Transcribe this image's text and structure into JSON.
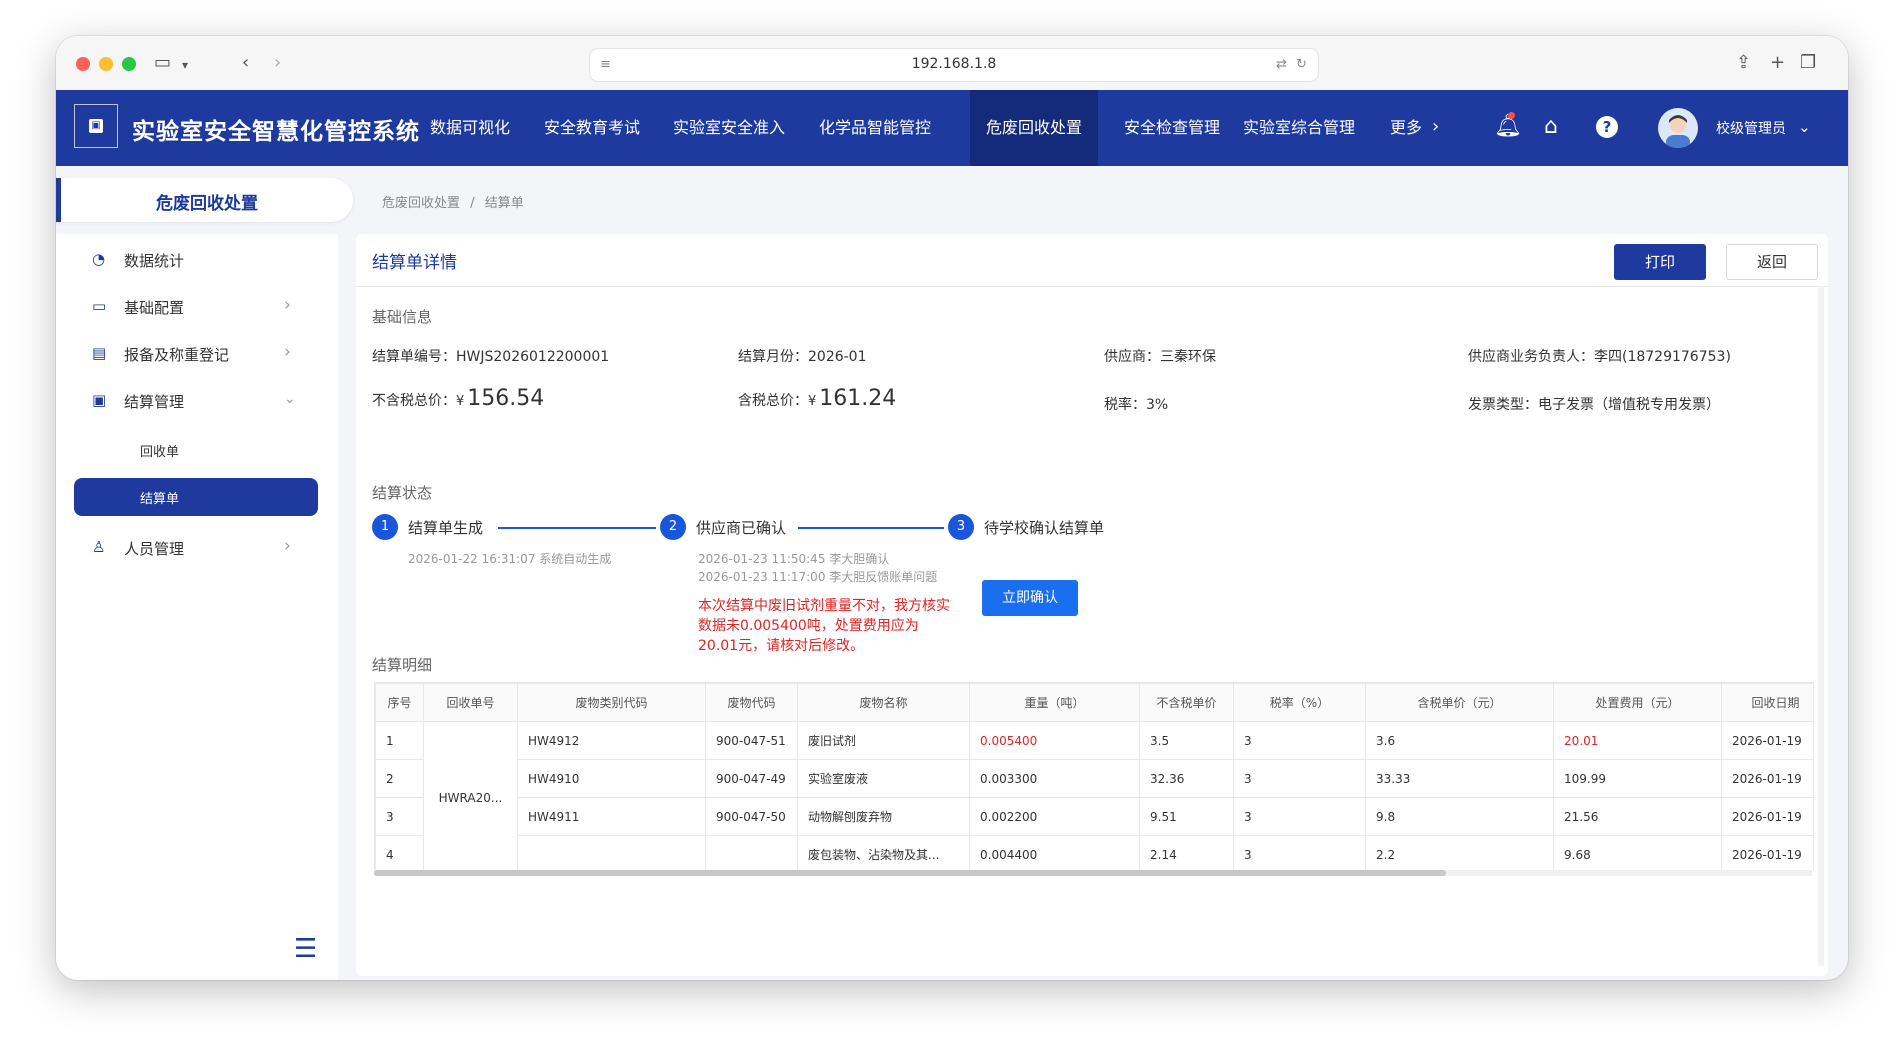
{
  "browser": {
    "url": "192.168.1.8"
  },
  "app": {
    "title": "实验室安全智慧化管控系统",
    "nav": [
      {
        "label": "数据可视化",
        "active": false
      },
      {
        "label": "安全教育考试",
        "active": false
      },
      {
        "label": "实验室安全准入",
        "active": false
      },
      {
        "label": "化学品智能管控",
        "active": false
      },
      {
        "label": "危废回收处置",
        "active": true
      },
      {
        "label": "安全检查管理",
        "active": false
      },
      {
        "label": "实验室综合管理",
        "active": false
      },
      {
        "label": "更多",
        "active": false
      }
    ],
    "user": "校级管理员",
    "colors": {
      "primary": "#1e3a9e",
      "accent": "#1a56db",
      "danger": "#e02424"
    }
  },
  "sidebar": {
    "header": "危废回收处置",
    "items": [
      {
        "label": "数据统计",
        "icon": "pie-chart-icon"
      },
      {
        "label": "基础配置",
        "icon": "monitor-icon"
      },
      {
        "label": "报备及称重登记",
        "icon": "document-icon"
      },
      {
        "label": "结算管理",
        "icon": "bill-icon"
      },
      {
        "label": "人员管理",
        "icon": "user-icon"
      }
    ],
    "subitems": [
      {
        "label": "回收单",
        "active": false
      },
      {
        "label": "结算单",
        "active": true
      }
    ]
  },
  "breadcrumb": {
    "parent": "危废回收处置",
    "separator": "/",
    "current": "结算单"
  },
  "card": {
    "title": "结算单详情",
    "print": "打印",
    "back": "返回"
  },
  "basic": {
    "section": "基础信息",
    "order_no_label": "结算单编号：",
    "order_no": "HWJS2026012200001",
    "month_label": "结算月份：",
    "month": "2026-01",
    "supplier_label": "供应商：",
    "supplier": "三秦环保",
    "contact_label": "供应商业务负责人：",
    "contact": "李四(18729176753)",
    "pretax_label": "不含税总价：",
    "pretax_currency": "¥",
    "pretax": "156.54",
    "taxed_label": "含税总价：",
    "taxed_currency": "¥",
    "taxed": "161.24",
    "taxrate_label": "税率：",
    "taxrate": "3%",
    "invoice_label": "发票类型：",
    "invoice": "电子发票（增值税专用发票）"
  },
  "status": {
    "section": "结算状态",
    "steps": [
      {
        "num": "1",
        "label": "结算单生成",
        "notes": [
          "2026-01-22 16:31:07 系统自动生成"
        ]
      },
      {
        "num": "2",
        "label": "供应商已确认",
        "notes": [
          "2026-01-23 11:50:45 李大胆确认",
          "2026-01-23 11:17:00 李大胆反馈账单问题"
        ]
      },
      {
        "num": "3",
        "label": "待学校确认结算单",
        "notes": []
      }
    ],
    "warning": "本次结算中废旧试剂重量不对，我方核实数据未0.005400吨，处置费用应为20.01元，请核对后修改。",
    "confirm_button": "立即确认"
  },
  "detail": {
    "section": "结算明细",
    "columns": [
      "序号",
      "回收单号",
      "废物类别代码",
      "废物代码",
      "废物名称",
      "重量（吨）",
      "不含税单价",
      "税率（%）",
      "含税单价（元）",
      "处置费用（元）",
      "回收日期"
    ],
    "merged_order": "HWRA20...",
    "rows": [
      {
        "idx": "1",
        "cat": "HW4912",
        "code": "900-047-51",
        "name": "废旧试剂",
        "weight": "0.005400",
        "price": "3.5",
        "rate": "3",
        "taxed": "3.6",
        "fee": "20.01",
        "date": "2026-01-19",
        "weight_red": true,
        "fee_red": true
      },
      {
        "idx": "2",
        "cat": "HW4910",
        "code": "900-047-49",
        "name": "实验室废液",
        "weight": "0.003300",
        "price": "32.36",
        "rate": "3",
        "taxed": "33.33",
        "fee": "109.99",
        "date": "2026-01-19",
        "weight_red": false,
        "fee_red": false
      },
      {
        "idx": "3",
        "cat": "HW4911",
        "code": "900-047-50",
        "name": "动物解刨废弃物",
        "weight": "0.002200",
        "price": "9.51",
        "rate": "3",
        "taxed": "9.8",
        "fee": "21.56",
        "date": "2026-01-19",
        "weight_red": false,
        "fee_red": false
      },
      {
        "idx": "4",
        "cat": "",
        "code": "",
        "name": "废包装物、沾染物及其...",
        "weight": "0.004400",
        "price": "2.14",
        "rate": "3",
        "taxed": "2.2",
        "fee": "9.68",
        "date": "2026-01-19",
        "weight_red": false,
        "fee_red": false
      }
    ]
  }
}
